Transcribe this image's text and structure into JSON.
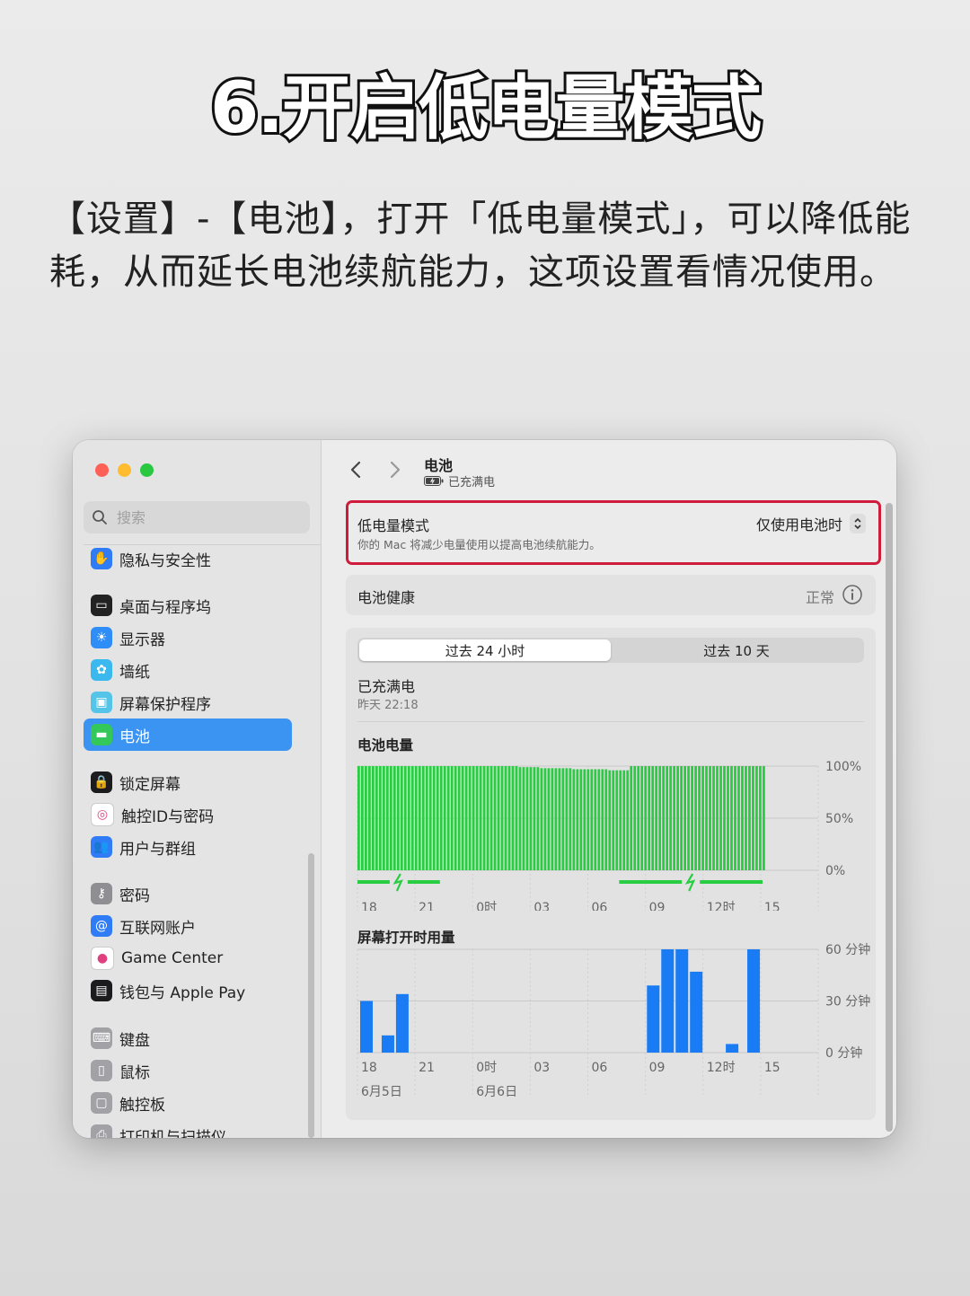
{
  "headline": "6.开启低电量模式",
  "intro": "【设置】-【电池】，打开「低电量模式」，可以降低能耗，从而延长电池续航能力，这项设置看情况使用。",
  "sidebar": {
    "search_placeholder": "搜索",
    "items": [
      {
        "label": "隐私与安全性",
        "icon": "hand-icon",
        "color": "#2f7cf6"
      },
      {
        "label": "桌面与程序坞",
        "icon": "dock-icon",
        "color": "#222222"
      },
      {
        "label": "显示器",
        "icon": "sun-icon",
        "color": "#2f8df7"
      },
      {
        "label": "墙纸",
        "icon": "flower-icon",
        "color": "#3bb9ef"
      },
      {
        "label": "屏幕保护程序",
        "icon": "screensaver-icon",
        "color": "#54c4e8"
      },
      {
        "label": "电池",
        "icon": "battery-icon",
        "color": "#34c759"
      },
      {
        "label": "锁定屏幕",
        "icon": "lock-icon",
        "color": "#1c1c1e"
      },
      {
        "label": "触控ID与密码",
        "icon": "fingerprint-icon",
        "color": "#ffffff"
      },
      {
        "label": "用户与群组",
        "icon": "users-icon",
        "color": "#2f7cf6"
      },
      {
        "label": "密码",
        "icon": "key-icon",
        "color": "#8e8e93"
      },
      {
        "label": "互联网账户",
        "icon": "at-icon",
        "color": "#2f7cf6"
      },
      {
        "label": "Game Center",
        "icon": "game-center-icon",
        "color": "#ffffff"
      },
      {
        "label": "钱包与 Apple Pay",
        "icon": "wallet-icon",
        "color": "#1c1c1e"
      },
      {
        "label": "键盘",
        "icon": "keyboard-icon",
        "color": "#a1a1a6"
      },
      {
        "label": "鼠标",
        "icon": "mouse-icon",
        "color": "#a1a1a6"
      },
      {
        "label": "触控板",
        "icon": "trackpad-icon",
        "color": "#a1a1a6"
      },
      {
        "label": "打印机与扫描仪",
        "icon": "printer-icon",
        "color": "#a1a1a6"
      }
    ]
  },
  "header": {
    "title": "电池",
    "subtitle": "已充满电"
  },
  "low_power": {
    "title": "低电量模式",
    "description": "你的 Mac 将减少电量使用以提高电池续航能力。",
    "value": "仅使用电池时"
  },
  "health": {
    "label": "电池健康",
    "value": "正常"
  },
  "tabs": {
    "active": "过去 24 小时",
    "inactive": "过去 10 天"
  },
  "status": {
    "text": "已充满电",
    "time": "昨天 22:18"
  },
  "colors": {
    "battery_green": "#28cd41",
    "usage_blue": "#1a7cf5",
    "highlight_red": "#d01c3c",
    "sidebar_selected": "#3b93f2"
  },
  "chart_data": [
    {
      "type": "bar",
      "title": "电池电量",
      "x_ticks": [
        "18",
        "21",
        "0时",
        "03",
        "06",
        "09",
        "12时",
        "15"
      ],
      "y_ticks": [
        "100%",
        "50%",
        "0%"
      ],
      "ylim": [
        0,
        100
      ],
      "series": [
        {
          "values": [
            100,
            100,
            100,
            100,
            100,
            100,
            100,
            100,
            100,
            100,
            100,
            100,
            100,
            100,
            100,
            100,
            100,
            100,
            100,
            100,
            100,
            100,
            100,
            100,
            100,
            100,
            100,
            100,
            100,
            100,
            100,
            100,
            100,
            100,
            100,
            100,
            100,
            100,
            100,
            100,
            100,
            100,
            100,
            100,
            100,
            99,
            99,
            99,
            99,
            99,
            99,
            98,
            98,
            98,
            98,
            98,
            98,
            98,
            98,
            98,
            97,
            97,
            97,
            97,
            97,
            97,
            97,
            97,
            97,
            97,
            96,
            96,
            96,
            96,
            96,
            96,
            100,
            100,
            100,
            100,
            100,
            100,
            100,
            100,
            100,
            100,
            100,
            100,
            100,
            100,
            100,
            100,
            100,
            100,
            100,
            100,
            100,
            100,
            100,
            100,
            100,
            100,
            100,
            100,
            100,
            100,
            100,
            100,
            100,
            100,
            100,
            100,
            100,
            100
          ]
        }
      ],
      "charging_periods": [
        [
          0,
          23
        ],
        [
          73,
          113
        ]
      ]
    },
    {
      "type": "bar",
      "title": "屏幕打开时用量",
      "x_ticks": [
        "18",
        "21",
        "0时",
        "03",
        "06",
        "09",
        "12时",
        "15"
      ],
      "y_ticks": [
        "60 分钟",
        "30 分钟",
        "0 分钟"
      ],
      "ylim": [
        0,
        60
      ],
      "series": [
        {
          "values": [
            30,
            0,
            0,
            10,
            0,
            34,
            0,
            0,
            0,
            0,
            0,
            0,
            0,
            0,
            0,
            0,
            0,
            0,
            0,
            0,
            0,
            0,
            0,
            0,
            0,
            0,
            0,
            0,
            0,
            0,
            0,
            0,
            0,
            0,
            0,
            0,
            0,
            0,
            0,
            0,
            39,
            0,
            60,
            0,
            60,
            0,
            47,
            0,
            0,
            0,
            0,
            5,
            0,
            0,
            60,
            0,
            0
          ]
        }
      ],
      "date_labels": [
        "6月5日",
        "6月6日"
      ]
    }
  ]
}
